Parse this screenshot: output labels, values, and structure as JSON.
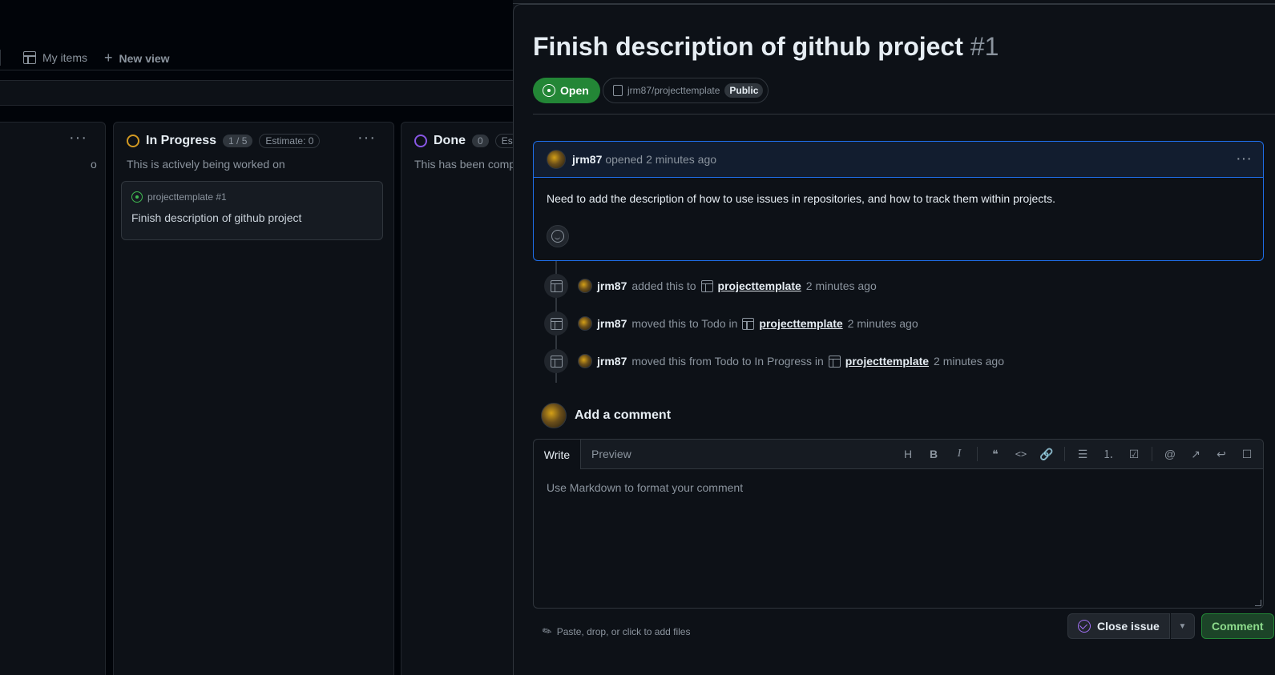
{
  "board": {
    "view_tabs": [
      {
        "label": "My items",
        "icon": "table-icon"
      },
      {
        "label": "New view",
        "icon": "plus-icon"
      }
    ],
    "columns": [
      {
        "title": "",
        "desc": "o",
        "menu": "···"
      },
      {
        "title": "In Progress",
        "count": "1 / 5",
        "estimate": "Estimate: 0",
        "desc": "This is actively being worked on",
        "ring_color": "#d29922",
        "menu": "···"
      },
      {
        "title": "Done",
        "count": "0",
        "estimate": "Est",
        "desc": "This has been comp",
        "ring_color": "#8957e5"
      }
    ],
    "card": {
      "meta": "projecttemplate #1",
      "title": "Finish description of github project"
    }
  },
  "issue": {
    "title": "Finish description of github project",
    "number": "#1",
    "state": "Open",
    "repo": "jrm87/projecttemplate",
    "visibility": "Public",
    "comment": {
      "author": "jrm87",
      "action": "opened",
      "time": "2 minutes ago",
      "body": "Need to add the description of how to use issues in repositories, and how to track them within projects.",
      "menu": "···"
    },
    "timeline": [
      {
        "user": "jrm87",
        "pre": "added this to",
        "project": "projecttemplate",
        "time": "2 minutes ago"
      },
      {
        "user": "jrm87",
        "pre": "moved this to Todo in",
        "project": "projecttemplate",
        "time": "2 minutes ago"
      },
      {
        "user": "jrm87",
        "pre": "moved this from Todo to In Progress in",
        "project": "projecttemplate",
        "time": "2 minutes ago"
      }
    ],
    "add_comment_heading": "Add a comment",
    "editor": {
      "tab_write": "Write",
      "tab_preview": "Preview",
      "placeholder": "Use Markdown to format your comment",
      "toolbar": [
        {
          "glyph": "H",
          "icon": "heading-icon"
        },
        {
          "glyph": "B",
          "icon": "bold-icon"
        },
        {
          "glyph": "I",
          "icon": "italic-icon"
        },
        {
          "glyph": "❝",
          "icon": "quote-icon"
        },
        {
          "glyph": "<>",
          "icon": "code-icon"
        },
        {
          "glyph": "🔗",
          "icon": "link-icon"
        },
        {
          "glyph": "☰",
          "icon": "unordered-list-icon"
        },
        {
          "glyph": "⒈",
          "icon": "ordered-list-icon"
        },
        {
          "glyph": "☑",
          "icon": "task-list-icon"
        },
        {
          "glyph": "@",
          "icon": "mention-icon"
        },
        {
          "glyph": "↗",
          "icon": "cross-reference-icon"
        },
        {
          "glyph": "↩",
          "icon": "saved-replies-icon"
        },
        {
          "glyph": "☐",
          "icon": "slash-commands-icon"
        }
      ]
    },
    "attach_text": "Paste, drop, or click to add files",
    "close_button": "Close issue",
    "comment_button": "Comment"
  },
  "colors": {
    "background": "#0d1117",
    "accent_blue": "#1f6feb",
    "open_green": "#238636",
    "done_purple": "#8957e5",
    "progress_yellow": "#d29922"
  }
}
